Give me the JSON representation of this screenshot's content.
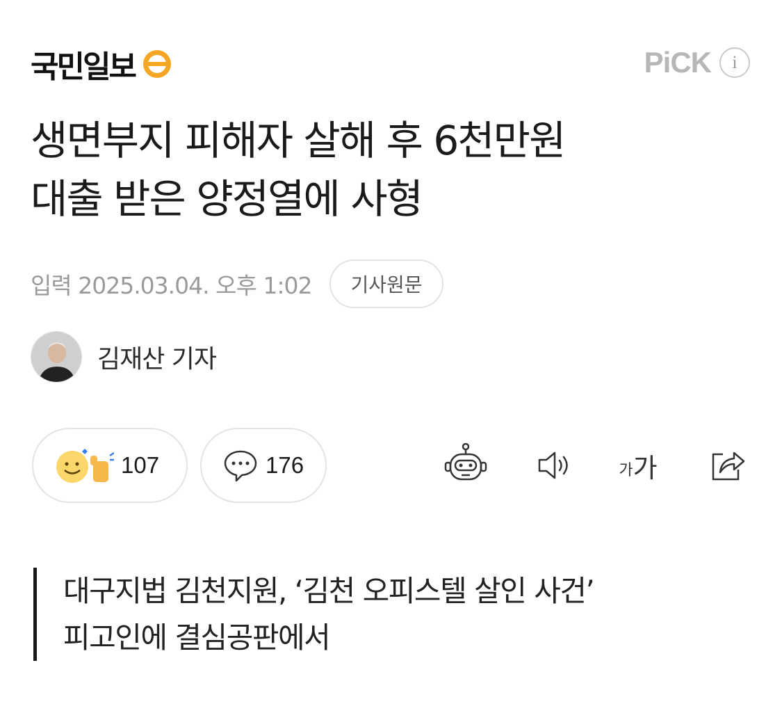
{
  "header": {
    "logo_text": "국민일보",
    "pick_label": "PiCK",
    "info_icon": "info-icon"
  },
  "article": {
    "headline_line1": "생면부지 피해자 살해 후 6천만원",
    "headline_line2": "대출 받은 양정열에 사형",
    "date": "입력 2025.03.04. 오후 1:02",
    "source_button": "기사원문",
    "author": "김재산 기자",
    "summary_line1": "대구지법 김천지원, ‘김천 오피스텔 살인 사건’",
    "summary_line2": "피고인에 결심공판에서"
  },
  "actions": {
    "reaction_count": "107",
    "comment_count": "176",
    "font_size_label_small": "가",
    "font_size_label_large": "가"
  },
  "colors": {
    "logo_accent": "#f5a623",
    "pick_gray": "#b7b7b7",
    "meta_gray": "#9a9a9a",
    "border_gray": "#e3e3e3"
  }
}
